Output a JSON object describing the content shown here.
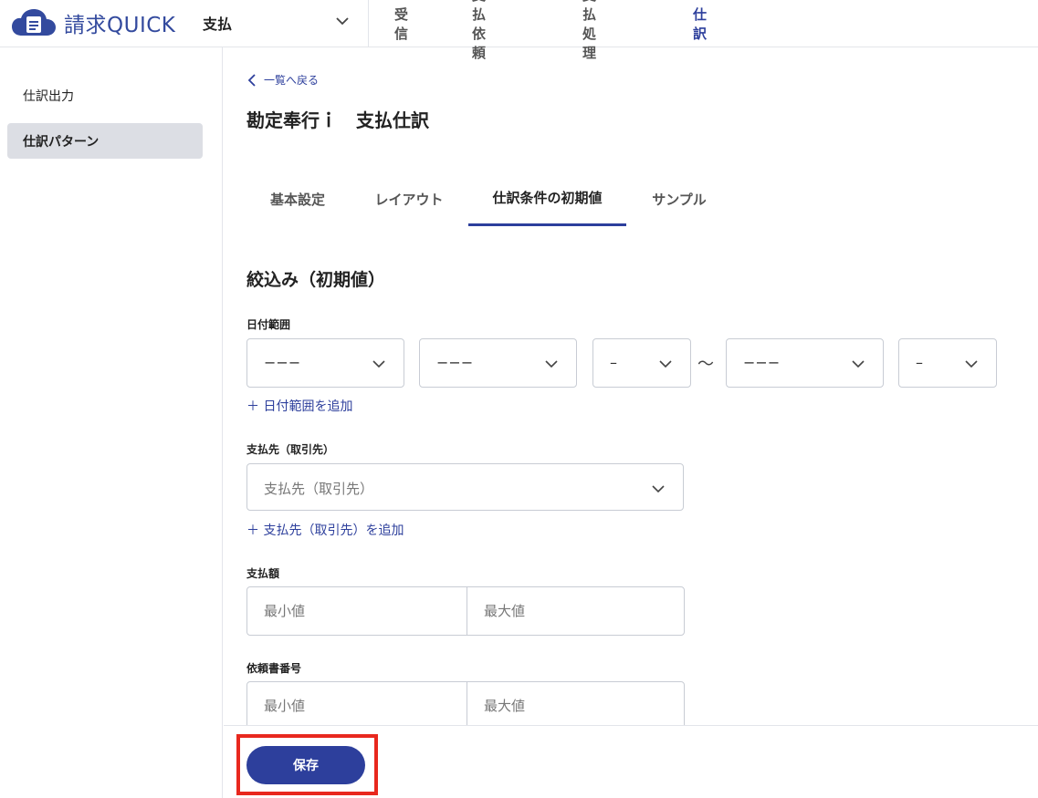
{
  "header": {
    "logo_text": "請求QUICK",
    "app_select_value": "支払",
    "nav": [
      {
        "label": "受信",
        "active": false
      },
      {
        "label": "支払依頼",
        "active": false
      },
      {
        "label": "支払処理",
        "active": false
      },
      {
        "label": "仕訳",
        "active": true
      }
    ]
  },
  "sidebar": {
    "items": [
      {
        "label": "仕訳出力",
        "active": false
      },
      {
        "label": "仕訳パターン",
        "active": true
      }
    ]
  },
  "main": {
    "back_label": "一覧へ戻る",
    "page_title": "勘定奉行ｉ　支払仕訳",
    "tabs": [
      {
        "label": "基本設定",
        "active": false
      },
      {
        "label": "レイアウト",
        "active": false
      },
      {
        "label": "仕訳条件の初期値",
        "active": true
      },
      {
        "label": "サンプル",
        "active": false
      }
    ],
    "section_title": "絞込み（初期値）",
    "date_range": {
      "label": "日付範囲",
      "selects": [
        "−−−",
        "−−−",
        "–",
        "−−−",
        "–"
      ],
      "separator": "〜",
      "add_label": "＋ 日付範囲を追加"
    },
    "payee": {
      "label": "支払先（取引先）",
      "placeholder": "支払先（取引先）",
      "add_label": "＋ 支払先（取引先）を追加"
    },
    "amount": {
      "label": "支払額",
      "min_placeholder": "最小値",
      "max_placeholder": "最大値"
    },
    "request_number": {
      "label": "依頼書番号",
      "min_placeholder": "最小値",
      "max_placeholder": "最大値"
    }
  },
  "footer": {
    "save_label": "保存"
  },
  "colors": {
    "brand": "#2d3f9c",
    "highlight": "#e8281e",
    "sidebar_active_bg": "#dcdee4"
  }
}
